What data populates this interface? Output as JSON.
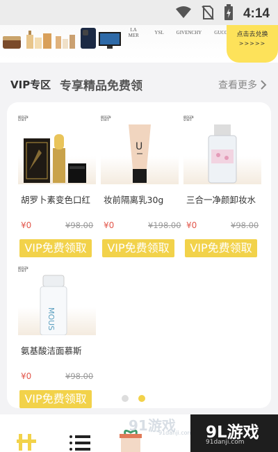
{
  "status_bar": {
    "time": "4:14",
    "icons": [
      "wifi-icon",
      "no-sim-icon",
      "battery-charging-icon"
    ]
  },
  "banner": {
    "brand_logos": [
      "LA MER",
      "YSL",
      "GIVENCHY",
      "GUCCI"
    ],
    "cta_label": "点击去兑换",
    "cta_arrows": ">>>>>"
  },
  "section": {
    "vip_title": "VIP专区",
    "subtitle": "专享精品免费领",
    "see_more": "查看更多"
  },
  "products": [
    {
      "name": "胡罗卜素变色口红",
      "vip_price": "¥0",
      "original_price": "¥98.00",
      "button": "VIP免费领取",
      "tag": "ORIGIN STAFF",
      "image": "lipstick"
    },
    {
      "name": "妆前隔离乳30g",
      "vip_price": "¥0",
      "original_price": "¥198.00",
      "button": "VIP免费领取",
      "tag": "ORIGIN STAFF",
      "image": "primer-tube"
    },
    {
      "name": "三合一净颜卸妆水",
      "vip_price": "¥0",
      "original_price": "¥98.00",
      "button": "VIP免费领取",
      "tag": "ORIGIN STAFF",
      "image": "micellar-bottle"
    },
    {
      "name": "氨基酸洁面慕斯",
      "vip_price": "¥0",
      "original_price": "¥98.00",
      "button": "VIP免费领取",
      "tag": "ORIGIN STAFF",
      "image": "mousse-bottle",
      "label_text": "MOUS"
    }
  ],
  "pagination": {
    "pages": 2,
    "active": 2
  },
  "tab_bar": {
    "tabs": [
      "grid-icon",
      "list-icon",
      "gift-icon"
    ]
  },
  "watermark": {
    "main": "9L游戏",
    "url": "91danji.com",
    "ghost": "91游戏",
    "ghost_url": "91danji.com"
  },
  "colors": {
    "accent": "#f2d24a",
    "banner_cta": "#fde25a",
    "price_red": "#e2574c"
  }
}
